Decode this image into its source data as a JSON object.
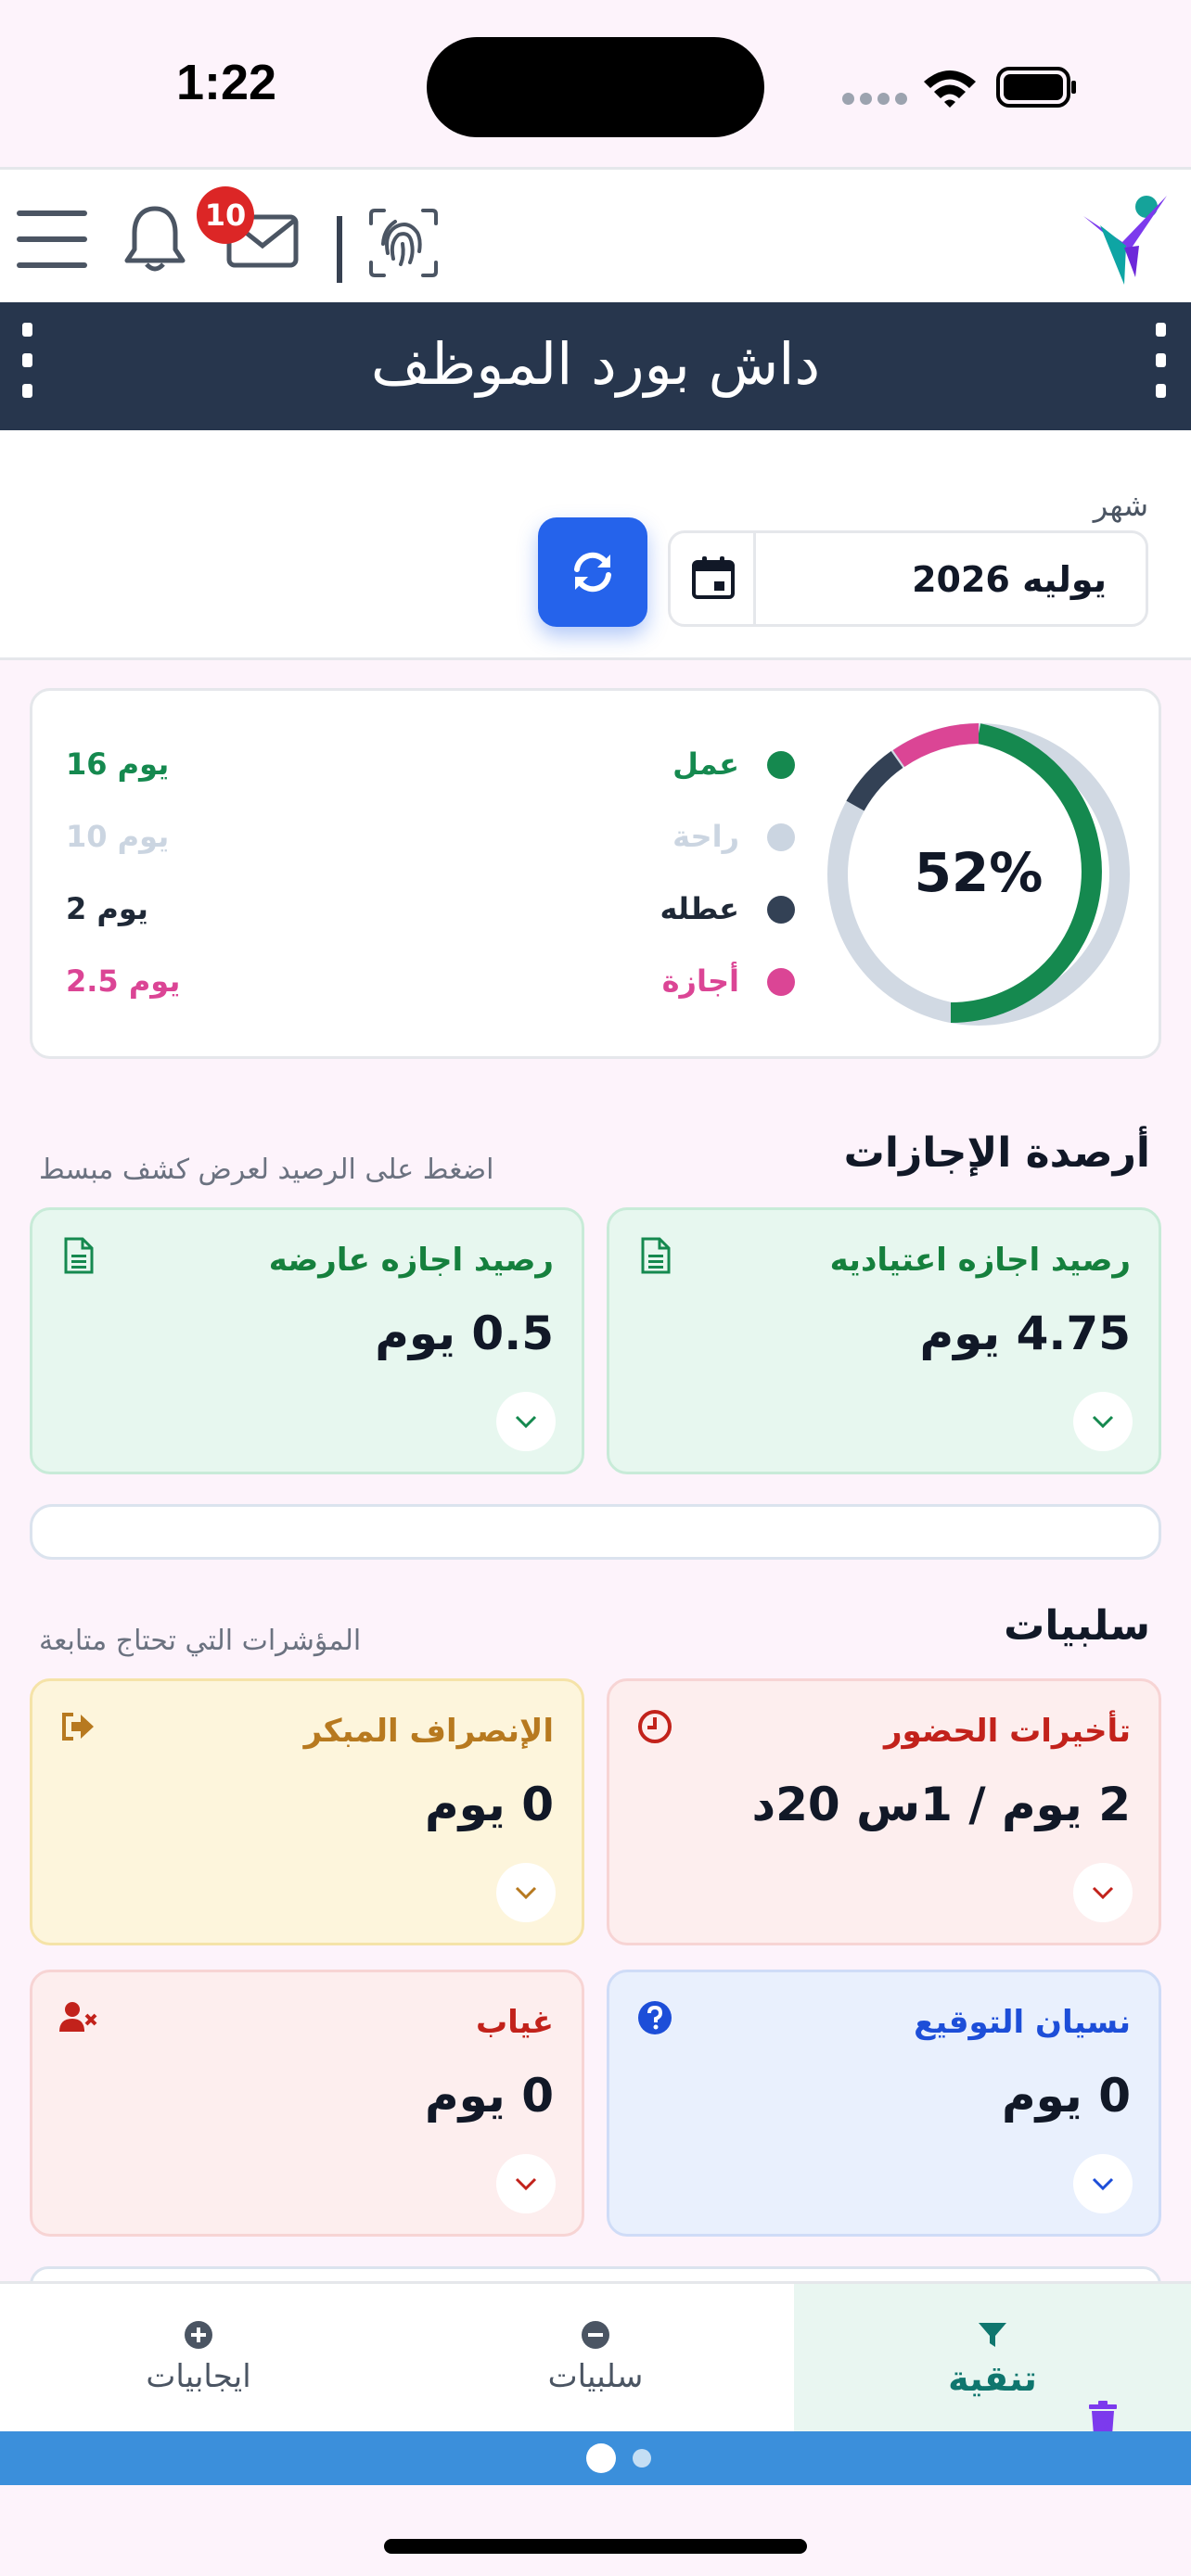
{
  "status_bar": {
    "time": "1:22"
  },
  "header": {
    "notification_count": "10",
    "page_title": "داش بورد الموظف"
  },
  "filter": {
    "month_label": "شهر",
    "month_value": "يوليه 2026"
  },
  "summary": {
    "percent_label": "52%",
    "legend": [
      {
        "label": "عمل",
        "value": "16 يوم",
        "color": "#15894f"
      },
      {
        "label": "راحة",
        "value": "10 يوم",
        "color": "#cbd5e1"
      },
      {
        "label": "عطله",
        "value": "2 يوم",
        "color": "#334155"
      },
      {
        "label": "أجازة",
        "value": "2.5 يوم",
        "color": "#db4595"
      }
    ]
  },
  "leave_section": {
    "title": "أرصدة الإجازات",
    "hint": "اضغط على الرصيد لعرض كشف مبسط",
    "cards": [
      {
        "title": "رصيد اجازه اعتياديه",
        "value": "4.75 يوم",
        "icon": "document-icon"
      },
      {
        "title": "رصيد اجازه عارضه",
        "value": "0.5 يوم",
        "icon": "document-icon"
      }
    ]
  },
  "negatives_section": {
    "title": "سلبيات",
    "hint": "المؤشرات التي تحتاج متابعة",
    "cards": [
      {
        "title": "تأخيرات الحضور",
        "value": "2 يوم / 1س 20د",
        "icon": "clock-icon"
      },
      {
        "title": "الإنصراف المبكر",
        "value": "0 يوم",
        "icon": "sign-out-icon"
      },
      {
        "title": "نسيان التوقيع",
        "value": "0 يوم",
        "icon": "question-icon"
      },
      {
        "title": "غياب",
        "value": "0 يوم",
        "icon": "user-times-icon"
      }
    ]
  },
  "bottom_tabs": [
    {
      "label": "تنقية",
      "icon": "filter-icon",
      "active": true
    },
    {
      "label": "سلبيات",
      "icon": "minus-circle-icon",
      "active": false
    },
    {
      "label": "ايجابيات",
      "icon": "plus-circle-icon",
      "active": false
    }
  ],
  "colors": {
    "primary_blue": "#2563eb",
    "title_bar": "#27364d",
    "pager_bar": "#3b8fdb",
    "donut_track": "#d1d9e3"
  }
}
